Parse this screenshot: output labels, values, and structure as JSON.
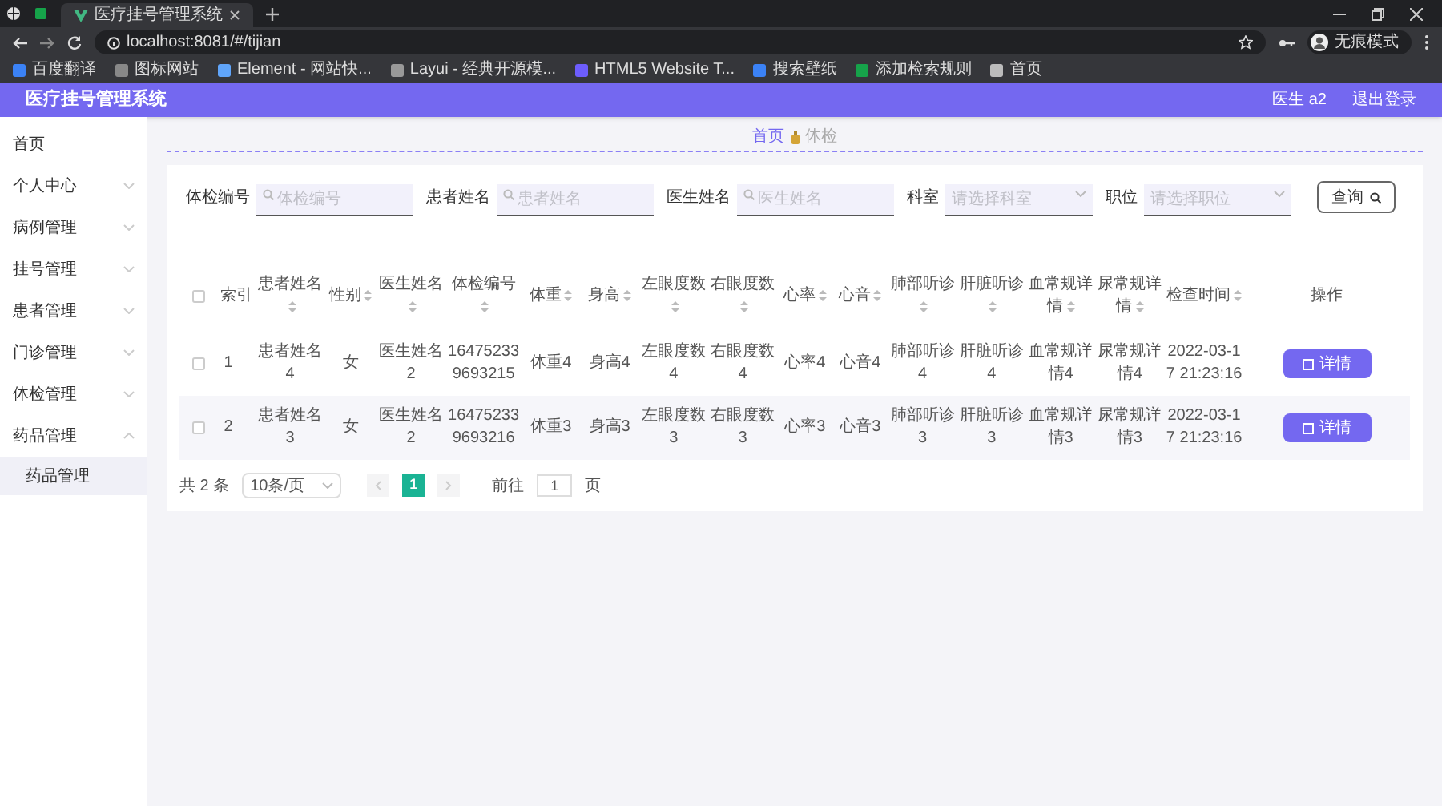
{
  "browser": {
    "tab_title": "医疗挂号管理系统",
    "url": "localhost:8081/#/tijian",
    "profile": "无痕模式",
    "bookmarks": [
      "百度翻译",
      "图标网站",
      "Element - 网站快...",
      "Layui - 经典开源模...",
      "HTML5 Website T...",
      "搜索壁纸",
      "添加检索规则",
      "首页"
    ]
  },
  "app": {
    "title": "医疗挂号管理系统",
    "user": "医生 a2",
    "logout": "退出登录"
  },
  "sidebar": {
    "items": [
      {
        "label": "首页"
      },
      {
        "label": "个人中心",
        "expanded": false
      },
      {
        "label": "病例管理",
        "expanded": false
      },
      {
        "label": "挂号管理",
        "expanded": false
      },
      {
        "label": "患者管理",
        "expanded": false
      },
      {
        "label": "门诊管理",
        "expanded": false
      },
      {
        "label": "体检管理",
        "expanded": false
      },
      {
        "label": "药品管理",
        "expanded": true,
        "children": [
          {
            "label": "药品管理",
            "selected": true
          }
        ]
      }
    ]
  },
  "breadcrumb": [
    "首页",
    "体检"
  ],
  "filters": [
    {
      "kind": "input",
      "label": "体检编号",
      "placeholder": "体检编号"
    },
    {
      "kind": "input",
      "label": "患者姓名",
      "placeholder": "患者姓名"
    },
    {
      "kind": "input",
      "label": "医生姓名",
      "placeholder": "医生姓名"
    },
    {
      "kind": "select",
      "label": "科室",
      "placeholder": "请选择科室"
    },
    {
      "kind": "select",
      "label": "职位",
      "placeholder": "请选择职位"
    }
  ],
  "search_button": "查询",
  "table": {
    "all_checked": false,
    "columns": [
      {
        "label": "索引",
        "sortable": false
      },
      {
        "label": "患者姓名",
        "sortable": true
      },
      {
        "label": "性别",
        "sortable": true
      },
      {
        "label": "医生姓名",
        "sortable": true
      },
      {
        "label": "体检编号",
        "sortable": true
      },
      {
        "label": "体重",
        "sortable": true
      },
      {
        "label": "身高",
        "sortable": true
      },
      {
        "label": "左眼度数",
        "sortable": true
      },
      {
        "label": "右眼度数",
        "sortable": true
      },
      {
        "label": "心率",
        "sortable": true
      },
      {
        "label": "心音",
        "sortable": true
      },
      {
        "label": "肺部听诊",
        "sortable": true
      },
      {
        "label": "肝脏听诊",
        "sortable": true
      },
      {
        "label": "血常规详情",
        "sortable": true
      },
      {
        "label": "尿常规详情",
        "sortable": true
      },
      {
        "label": "检查时间",
        "sortable": true
      },
      {
        "label": "操作",
        "sortable": false
      }
    ],
    "rows": [
      {
        "checked": false,
        "cells": [
          "1",
          "患者姓名4",
          "女",
          "医生姓名2",
          "164752339693215",
          "体重4",
          "身高4",
          "左眼度数4",
          "右眼度数4",
          "心率4",
          "心音4",
          "肺部听诊4",
          "肝脏听诊4",
          "血常规详情4",
          "尿常规详情4",
          "2022-03-17 21:23:16"
        ],
        "action": "详情"
      },
      {
        "checked": false,
        "cells": [
          "2",
          "患者姓名3",
          "女",
          "医生姓名2",
          "164752339693216",
          "体重3",
          "身高3",
          "左眼度数3",
          "右眼度数3",
          "心率3",
          "心音3",
          "肺部听诊3",
          "肝脏听诊3",
          "血常规详情3",
          "尿常规详情3",
          "2022-03-17 21:23:16"
        ],
        "action": "详情"
      }
    ]
  },
  "pagination": {
    "total": "共 2 条",
    "page_size": "10条/页",
    "pages": [
      {
        "label": "1",
        "selected": true
      }
    ],
    "goto_label": "前往",
    "goto_value": "1",
    "goto_suffix": "页"
  }
}
